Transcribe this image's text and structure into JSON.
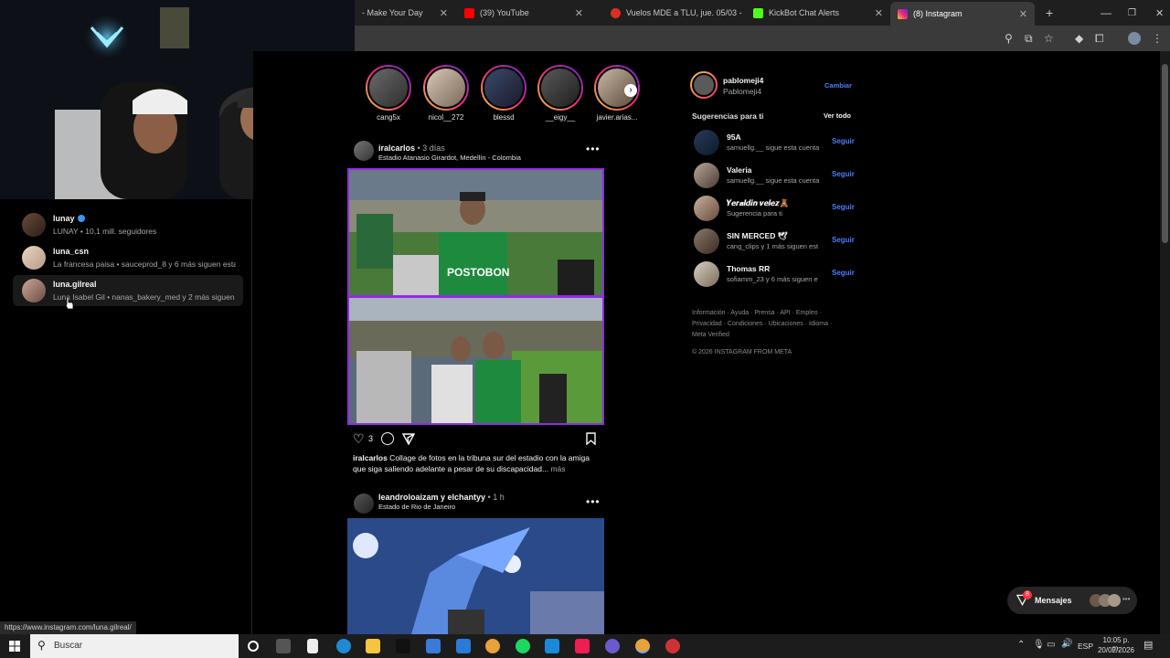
{
  "tabs": [
    {
      "label": "- Make Your Day",
      "color": ""
    },
    {
      "label": "(39) YouTube",
      "color": "#ff0000"
    },
    {
      "label": "Vuelos MDE a TLU, jue. 05/03 -",
      "color": "#d93025"
    },
    {
      "label": "KickBot Chat Alerts",
      "color": "#53fc18"
    },
    {
      "label": "(8) Instagram",
      "color": "#e1306c"
    }
  ],
  "search_results": [
    {
      "name": "lunay",
      "verified": true,
      "sub": "LUNAY • 10,1 mill. seguidores"
    },
    {
      "name": "luna_csn",
      "verified": false,
      "sub": "La francesa paisa • sauceprod_8 y 6 más siguen esta c"
    },
    {
      "name": "luna.gilreal",
      "verified": false,
      "sub": "Luna Isabel Gil • nanas_bakery_med y 2 más siguen es"
    }
  ],
  "status_url": "https://www.instagram.com/luna.gilreal/",
  "stories": [
    {
      "name": "cang5x"
    },
    {
      "name": "nicol__272"
    },
    {
      "name": "blessd"
    },
    {
      "name": "__eigy__"
    },
    {
      "name": "javier.arias..."
    }
  ],
  "post1": {
    "user": "iralcarlos",
    "time": " • 3 días",
    "location": "Estadio Atanasio Girardot, Medellín - Colombia",
    "likes": "3",
    "caption_user": "iralcarlos",
    "caption_text": " Collage de fotos en la tribuna sur del estadio con la amiga que siga saliendo adelante a pesar de su discapacidad...",
    "more": " más",
    "jersey_text": "POSTOBON"
  },
  "post2": {
    "user": "leandroloaizam y elchantyy",
    "time": " • 1 h",
    "location": "Estado de Rio de Janeiro"
  },
  "profile": {
    "username": "pablomeji4",
    "name": "Pablomeji4",
    "switch": "Cambiar"
  },
  "suggestions_header": {
    "title": "Sugerencias para ti",
    "see_all": "Ver todo"
  },
  "suggestions": [
    {
      "name": "95A",
      "sub": "samuellg.__ sigue esta cuenta",
      "follow": "Seguir"
    },
    {
      "name": "Valeria",
      "sub": "samuellg.__ sigue esta cuenta",
      "follow": "Seguir"
    },
    {
      "name": "𝒀𝒆𝒓𝒂𝒍𝒅𝒊𝒏 𝒗𝒆𝒍𝒆𝒛🧸",
      "sub": "Sugerencia para ti",
      "follow": "Seguir"
    },
    {
      "name": "SIN MERCED 🕊",
      "sub": "cang_clips y 1 más siguen est",
      "follow": "Seguir"
    },
    {
      "name": "Thomas RR",
      "sub": "sofiamm_23 y 6 más siguen e",
      "follow": "Seguir"
    }
  ],
  "footer_links": {
    "line1": "Información · Ayuda · Prensa · API · Empleo ·",
    "line2": "Privacidad · Condiciones · Ubicaciones · Idioma ·",
    "line3": "Meta Verified",
    "copyright": "© 2026 INSTAGRAM FROM META"
  },
  "messages": {
    "label": "Mensajes",
    "badge": "8"
  },
  "taskbar": {
    "search": "Buscar",
    "lang": "ESP",
    "time": "10:05 p. m.",
    "date": "20/02/2026"
  },
  "colors": {
    "accent": "#4a7dff",
    "bg": "#000000",
    "post_border": "#8e2de2"
  }
}
